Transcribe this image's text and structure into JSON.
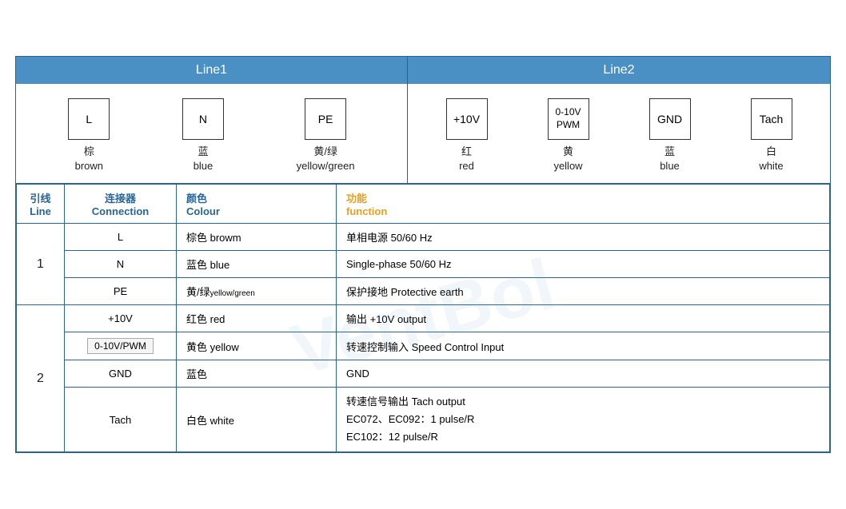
{
  "header": {
    "line1": "Line1",
    "line2": "Line2"
  },
  "line1_connectors": [
    {
      "id": "L",
      "label_cn": "棕",
      "label_en": "brown"
    },
    {
      "id": "N",
      "label_cn": "蓝",
      "label_en": "blue"
    },
    {
      "id": "PE",
      "label_cn": "黄/绿",
      "label_en": "yellow/green"
    }
  ],
  "line2_connectors": [
    {
      "id": "+10V",
      "label_cn": "红",
      "label_en": "red"
    },
    {
      "id": "0-10V\nPWM",
      "label_cn": "黄",
      "label_en": "yellow"
    },
    {
      "id": "GND",
      "label_cn": "蓝",
      "label_en": "blue"
    },
    {
      "id": "Tach",
      "label_cn": "白",
      "label_en": "white"
    }
  ],
  "table": {
    "headers": {
      "line": "引线\nLine",
      "connection": "连接器\nConnection",
      "colour": "颜色\nColour",
      "function": "功能\nfunction"
    },
    "rows": [
      {
        "line": "1",
        "rowspan": 3,
        "entries": [
          {
            "connection": "L",
            "colour": "棕色 browm",
            "function": "单相电源 50/60 Hz"
          },
          {
            "connection": "N",
            "colour": "蓝色 blue",
            "function": "Single-phase 50/60 Hz"
          },
          {
            "connection": "PE",
            "colour": "黄/绿yellow/green",
            "function": "保护接地 Protective earth"
          }
        ]
      },
      {
        "line": "2",
        "rowspan": 4,
        "entries": [
          {
            "connection": "+10V",
            "colour": "红色 red",
            "function": "输出 +10V output"
          },
          {
            "connection": "0-10V/PWM",
            "colour": "黄色 yellow",
            "function": "转速控制输入 Speed Control Input"
          },
          {
            "connection": "GND",
            "colour": "蓝色",
            "function": "GND"
          },
          {
            "connection": "Tach",
            "colour": "白色 white",
            "function": "转速信号输出 Tach output\nEC072、EC092：1 pulse/R\nEC102：12 pulse/R"
          }
        ]
      }
    ]
  }
}
